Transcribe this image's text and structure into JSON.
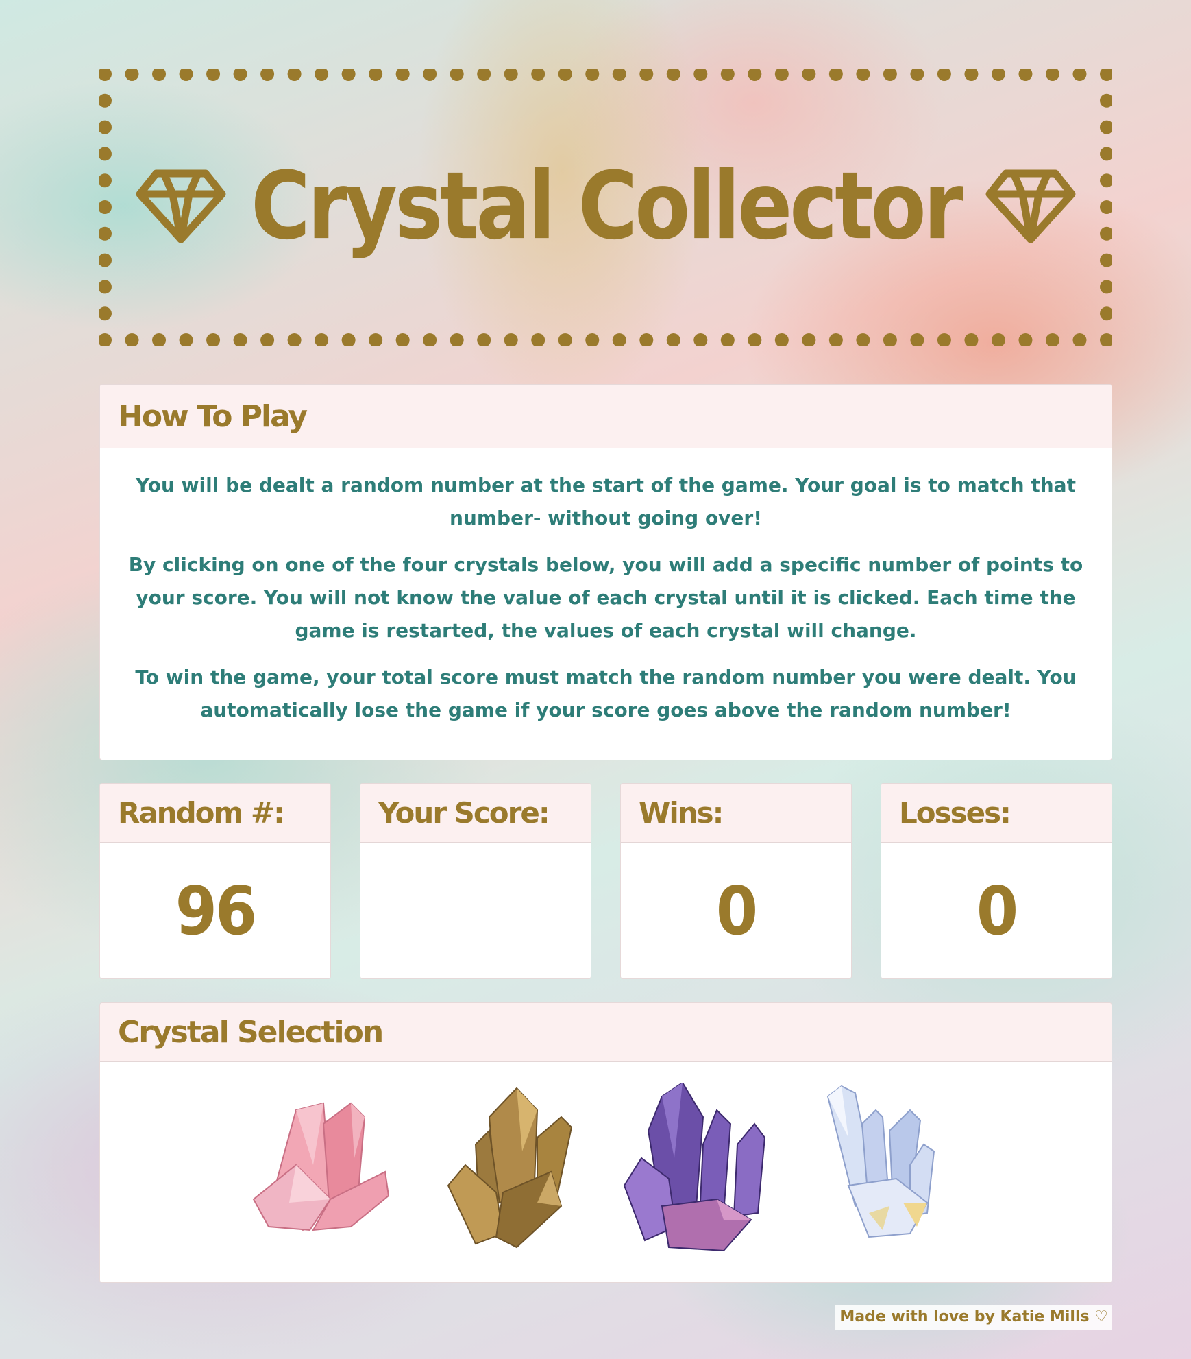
{
  "title": {
    "text": "Crystal Collector",
    "left_icon": "diamond-icon",
    "right_icon": "diamond-icon",
    "color": "#9a7a2c"
  },
  "how_to_play": {
    "heading": "How To Play",
    "paragraphs": [
      "You will be dealt a random number at the start of the game. Your goal is to match that number- without going over!",
      "By clicking on one of the four crystals below, you will add a specific number of points to your score. You will not know the value of each crystal until it is clicked. Each time the game is restarted, the values of each crystal will change.",
      "To win the game, your total score must match the random number you were dealt. You automatically lose the game if your score goes above the random number!"
    ],
    "text_color": "#2e7d78"
  },
  "stats": {
    "random": {
      "label": "Random #:",
      "value": "96"
    },
    "score": {
      "label": "Your Score:",
      "value": ""
    },
    "wins": {
      "label": "Wins:",
      "value": "0"
    },
    "losses": {
      "label": "Losses:",
      "value": "0"
    }
  },
  "crystal_selection": {
    "heading": "Crystal Selection",
    "crystals": [
      {
        "name": "pink-crystal",
        "color": "#e88a9c"
      },
      {
        "name": "gold-crystal",
        "color": "#b08a4a"
      },
      {
        "name": "purple-crystal",
        "color": "#6b4fa8"
      },
      {
        "name": "clear-crystal",
        "color": "#b9c8ea"
      }
    ]
  },
  "footer": {
    "credit": "Made with love by Katie Mills ♡"
  },
  "colors": {
    "accent_gold": "#9a7a2c",
    "header_bg": "#fcf0f0",
    "body_text_teal": "#2e7d78"
  }
}
